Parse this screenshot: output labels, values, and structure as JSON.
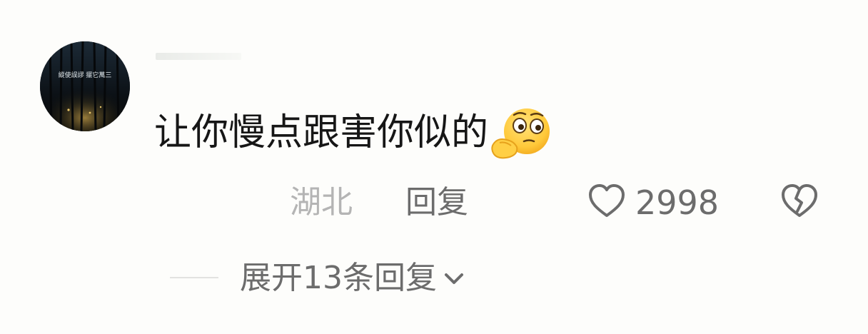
{
  "avatar": {
    "icon": "forest-night-avatar",
    "overlay_text": "縱使誤謬 擺它萬三"
  },
  "comment": {
    "text": "让你慢点跟害你似的",
    "emoji": "thinking-face-emoji"
  },
  "meta": {
    "location": "湖北",
    "reply_label": "回复",
    "like_icon": "heart-icon",
    "like_count": "2998",
    "dislike_icon": "broken-heart-icon"
  },
  "replies": {
    "expand_label": "展开13条回复",
    "expand_icon": "chevron-down-icon"
  },
  "colors": {
    "background": "#fdfdfb",
    "primary_text": "#161616",
    "secondary_text": "#6c6c6c",
    "location_text": "#b4b4b4"
  }
}
